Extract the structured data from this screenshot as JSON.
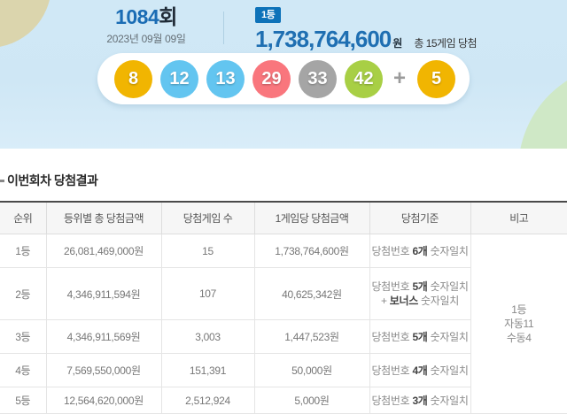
{
  "colors": {
    "accent_blue": "#1f6fb2",
    "badge_blue": "#0d72b9",
    "header_bg_top": "#d0e8f6",
    "header_bg_bottom": "#d9edf9",
    "ball_yellow": "#f1b501",
    "ball_blue": "#63c5f0",
    "ball_red": "#f9767d",
    "ball_gray": "#a5a5a5",
    "ball_green": "#a8cf45"
  },
  "header": {
    "round_number": "1084",
    "round_suffix": "회",
    "date": "2023년 09월 09일",
    "rank_badge": "1등",
    "prize_amount": "1,738,764,600",
    "prize_currency": "원",
    "prize_note": "총 15게임 당첨",
    "plus_sign": "+",
    "balls": [
      {
        "number": "8",
        "color": "#f1b501"
      },
      {
        "number": "12",
        "color": "#63c5f0"
      },
      {
        "number": "13",
        "color": "#63c5f0"
      },
      {
        "number": "29",
        "color": "#f9767d"
      },
      {
        "number": "33",
        "color": "#a5a5a5"
      },
      {
        "number": "42",
        "color": "#a8cf45"
      }
    ],
    "bonus_ball": {
      "number": "5",
      "color": "#f1b501"
    }
  },
  "section": {
    "title": "이번회차 당첨결과"
  },
  "table": {
    "headers": [
      "순위",
      "등위별 총 당첨금액",
      "당첨게임 수",
      "1게임당 당첨금액",
      "당첨기준",
      "비고"
    ],
    "rows": [
      {
        "rank": "1등",
        "total": "26,081,469,000원",
        "games": "15",
        "per_game": "1,738,764,600원",
        "criteria": [
          [
            {
              "t": "당첨번호 "
            },
            {
              "t": "6개",
              "b": 1
            },
            {
              "t": " 숫자일치"
            }
          ]
        ]
      },
      {
        "rank": "2등",
        "total": "4,346,911,594원",
        "games": "107",
        "per_game": "40,625,342원",
        "criteria": [
          [
            {
              "t": "당첨번호 "
            },
            {
              "t": "5개",
              "b": 1
            },
            {
              "t": " 숫자일치"
            }
          ],
          [
            {
              "t": "+ "
            },
            {
              "t": "보너스",
              "b": 1
            },
            {
              "t": " 숫자일치"
            }
          ]
        ]
      },
      {
        "rank": "3등",
        "total": "4,346,911,569원",
        "games": "3,003",
        "per_game": "1,447,523원",
        "criteria": [
          [
            {
              "t": "당첨번호 "
            },
            {
              "t": "5개",
              "b": 1
            },
            {
              "t": " 숫자일치"
            }
          ]
        ]
      },
      {
        "rank": "4등",
        "total": "7,569,550,000원",
        "games": "151,391",
        "per_game": "50,000원",
        "criteria": [
          [
            {
              "t": "당첨번호 "
            },
            {
              "t": "4개",
              "b": 1
            },
            {
              "t": " 숫자일치"
            }
          ]
        ]
      },
      {
        "rank": "5등",
        "total": "12,564,620,000원",
        "games": "2,512,924",
        "per_game": "5,000원",
        "criteria": [
          [
            {
              "t": "당첨번호 "
            },
            {
              "t": "3개",
              "b": 1
            },
            {
              "t": " 숫자일치"
            }
          ]
        ]
      }
    ],
    "remark_lines": [
      "1등",
      "자동11",
      "수동4"
    ]
  }
}
